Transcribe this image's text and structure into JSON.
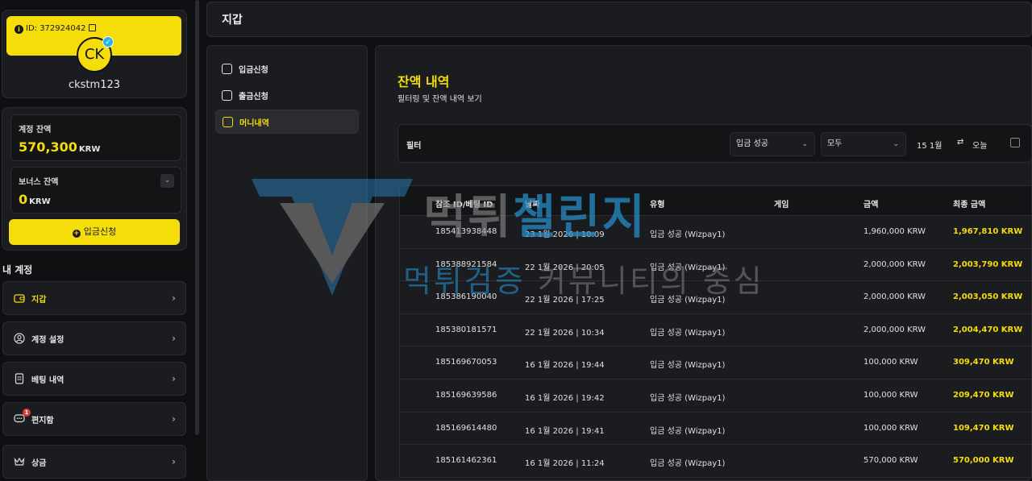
{
  "profile": {
    "id_label": "ID: 372924042",
    "avatar_initials": "CK",
    "username": "ckstm123"
  },
  "balances": {
    "account_label": "계정 잔액",
    "account_value": "570,300",
    "account_unit": "KRW",
    "bonus_label": "보너스 잔액",
    "bonus_value": "0",
    "bonus_unit": "KRW",
    "deposit_button": "입금신청"
  },
  "my_account": {
    "title": "내 계정",
    "items": [
      {
        "label": "지갑",
        "icon": "wallet-icon",
        "active": true
      },
      {
        "label": "계정 설정",
        "icon": "user-icon"
      },
      {
        "label": "베팅 내역",
        "icon": "receipt-icon"
      },
      {
        "label": "편지함",
        "icon": "message-icon",
        "badge": "1"
      },
      {
        "label": "상금",
        "icon": "crown-icon"
      }
    ]
  },
  "header": {
    "title": "지갑"
  },
  "subnav": {
    "items": [
      {
        "label": "입금신청",
        "icon": "download-icon"
      },
      {
        "label": "출금신청",
        "icon": "upload-icon"
      },
      {
        "label": "머니내역",
        "icon": "history-icon",
        "active": true
      }
    ]
  },
  "main": {
    "title": "잔액 내역",
    "subtitle": "필터링 및 잔액 내역 보기"
  },
  "filter": {
    "label": "필터",
    "type_select": "입금 성공",
    "scope_select": "모두",
    "date_from": "15 1월",
    "date_to": "오늘"
  },
  "table": {
    "columns": [
      "참조 ID/베팅 ID",
      "날짜",
      "유형",
      "게임",
      "금액",
      "최종 금액"
    ],
    "rows": [
      [
        "185413938448",
        "23 1월 2026 | 10:09",
        "입금 성공 (Wizpay1)",
        "",
        "1,960,000 KRW",
        "1,967,810 KRW"
      ],
      [
        "185388921584",
        "22 1월 2026 | 20:05",
        "입금 성공 (Wizpay1)",
        "",
        "2,000,000 KRW",
        "2,003,790 KRW"
      ],
      [
        "185386190040",
        "22 1월 2026 | 17:25",
        "입금 성공 (Wizpay1)",
        "",
        "2,000,000 KRW",
        "2,003,050 KRW"
      ],
      [
        "185380181571",
        "22 1월 2026 | 10:34",
        "입금 성공 (Wizpay1)",
        "",
        "2,000,000 KRW",
        "2,004,470 KRW"
      ],
      [
        "185169670053",
        "16 1월 2026 | 19:44",
        "입금 성공 (Wizpay1)",
        "",
        "100,000 KRW",
        "309,470 KRW"
      ],
      [
        "185169639586",
        "16 1월 2026 | 19:42",
        "입금 성공 (Wizpay1)",
        "",
        "100,000 KRW",
        "209,470 KRW"
      ],
      [
        "185169614480",
        "16 1월 2026 | 19:41",
        "입금 성공 (Wizpay1)",
        "",
        "100,000 KRW",
        "109,470 KRW"
      ],
      [
        "185161462361",
        "16 1월 2026 | 11:24",
        "입금 성공 (Wizpay1)",
        "",
        "570,000 KRW",
        "570,000 KRW"
      ]
    ]
  },
  "watermark": {
    "title_part1": "먹튀",
    "title_part2": "챌린지",
    "sub_part1": "먹튀검증",
    "sub_part2": "커뮤니티의 중심"
  },
  "colors": {
    "accent": "#f5dd0a",
    "panel": "#1b1c1f",
    "background": "#0f1012"
  }
}
